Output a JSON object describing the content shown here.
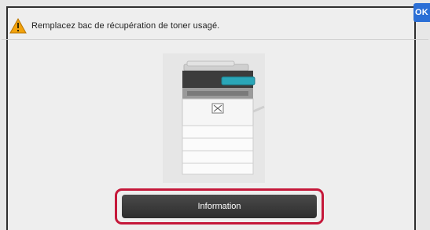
{
  "message": {
    "icon": "warning-icon",
    "text": "Remplacez bac de récupération de toner usagé."
  },
  "ok_button": {
    "label": "OK"
  },
  "illustration": {
    "name": "printer-icon"
  },
  "info_button": {
    "label": "Information"
  },
  "colors": {
    "ok_blue": "#2b6fd6",
    "highlight_red": "#c5183a",
    "warning_orange": "#f2a20c",
    "button_dark": "#333333",
    "panel_accent_teal": "#2aa6b8"
  }
}
